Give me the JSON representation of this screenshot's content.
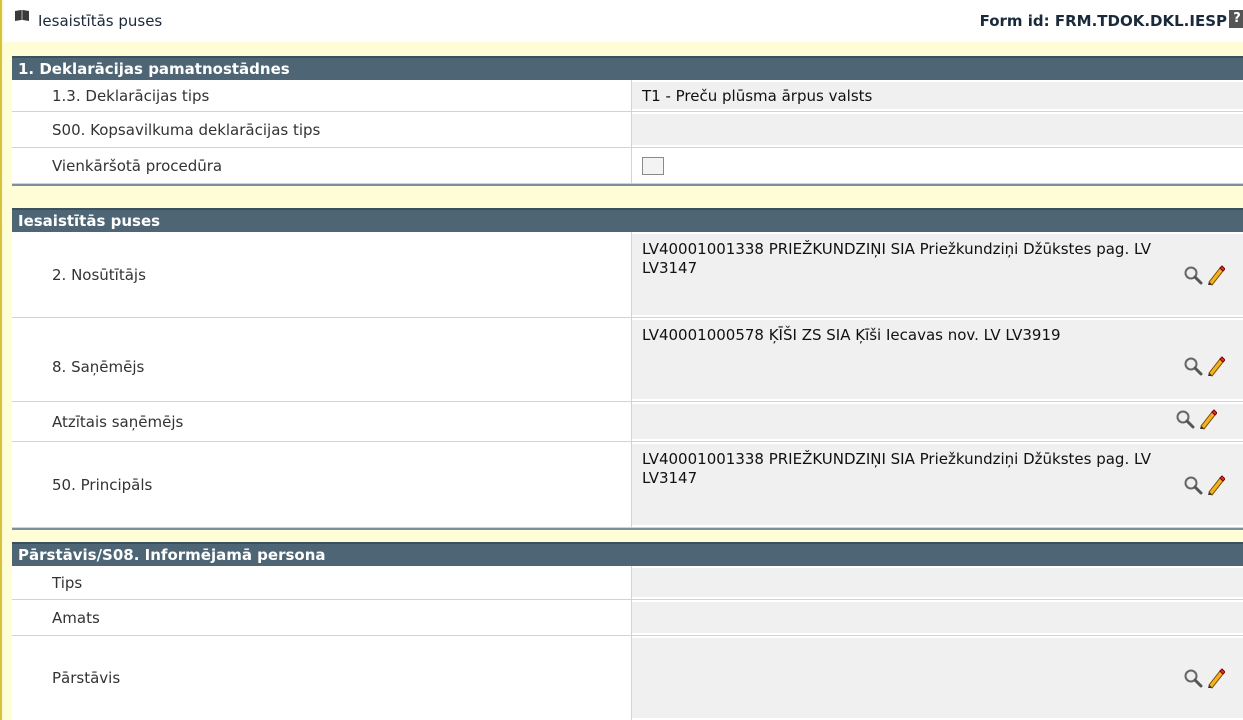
{
  "window": {
    "title": "Iesaistītās puses",
    "form_id": "Form id: FRM.TDOK.DKL.IESP",
    "help_glyph": "?"
  },
  "sections": [
    {
      "title": "1. Deklarācijas pamatnostādnes",
      "rows": [
        {
          "label": "1.3. Deklarācijas tips",
          "value": "T1 - Preču plūsma ārpus valsts"
        },
        {
          "label": "S00. Kopsavilkuma deklarācijas tips",
          "value": ""
        },
        {
          "label": "Vienkāršotā procedūra",
          "value": "",
          "checkbox": false
        }
      ]
    },
    {
      "title": "Iesaistītās puses",
      "rows": [
        {
          "label": "2. Nosūtītājs",
          "value": "LV40001001338 PRIEŽKUNDZIŅI SIA Priežkundziņi Džūkstes pag. LV LV3147"
        },
        {
          "label": "8. Saņēmējs",
          "value": "LV40001000578 ĶĪŠI ZS SIA Ķīši Iecavas nov. LV LV3919"
        },
        {
          "label": "Atzītais saņēmējs",
          "value": ""
        },
        {
          "label": "50. Principāls",
          "value": "LV40001001338 PRIEŽKUNDZIŅI SIA Priežkundziņi Džūkstes pag. LV LV3147"
        }
      ]
    },
    {
      "title": "Pārstāvis/S08. Informējamā persona",
      "rows": [
        {
          "label": "Tips",
          "value": ""
        },
        {
          "label": "Amats",
          "value": ""
        },
        {
          "label": "Pārstāvis",
          "value": ""
        }
      ]
    }
  ],
  "icons": {
    "title": "book-icon",
    "search": "magnifier-icon",
    "edit": "pencil-icon"
  },
  "colors": {
    "section_header": "#4d6574",
    "frame_background": "#fffdd6",
    "field_background": "#f0f0f0"
  }
}
